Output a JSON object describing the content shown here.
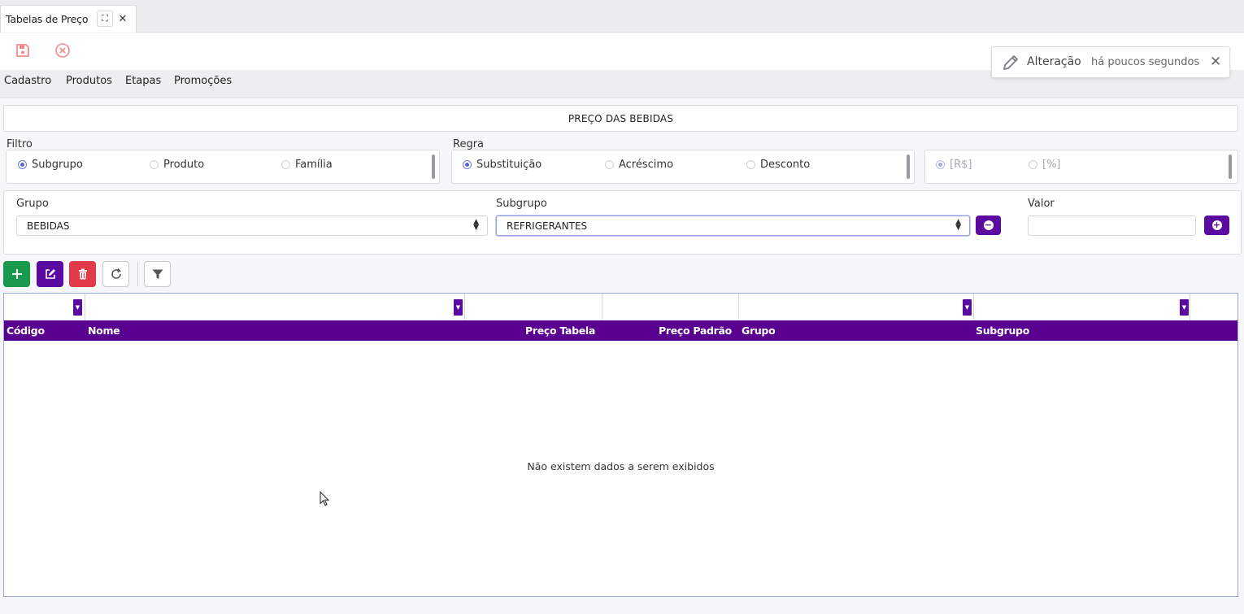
{
  "tab": {
    "title": "Tabelas de Preço",
    "expand_glyph": "⛶",
    "close_glyph": "✕"
  },
  "toolbar": {
    "save_icon": "save-icon",
    "cancel_icon": "cancel-icon"
  },
  "menu": {
    "items": [
      "Cadastro",
      "Produtos",
      "Etapas",
      "Promoções"
    ]
  },
  "notification": {
    "title": "Alteração",
    "time": "há poucos segundos",
    "close_glyph": "✕"
  },
  "panel": {
    "title": "PREÇO DAS BEBIDAS"
  },
  "filtro": {
    "label": "Filtro",
    "options": [
      "Subgrupo",
      "Produto",
      "Família"
    ],
    "selected": "Subgrupo"
  },
  "regra": {
    "label": "Regra",
    "options": [
      "Substituição",
      "Acréscimo",
      "Desconto"
    ],
    "selected": "Substituição"
  },
  "unit": {
    "options": [
      "[R$]",
      "[%]"
    ],
    "selected": "[R$]"
  },
  "fields": {
    "grupo_label": "Grupo",
    "grupo_value": "BEBIDAS",
    "subgrupo_label": "Subgrupo",
    "subgrupo_value": "REFRIGERANTES",
    "valor_label": "Valor",
    "valor_value": ""
  },
  "grid": {
    "columns": [
      "Código",
      "Nome",
      "Preço Tabela",
      "Preço Padrão",
      "Grupo",
      "Subgrupo"
    ],
    "empty_message": "Não existem dados a serem exibidos"
  },
  "colors": {
    "accent": "#5a0aa0",
    "header": "#5a0090",
    "add": "#179a4c",
    "delete": "#e23a48",
    "toolbar_icon": "#f08a8a"
  }
}
